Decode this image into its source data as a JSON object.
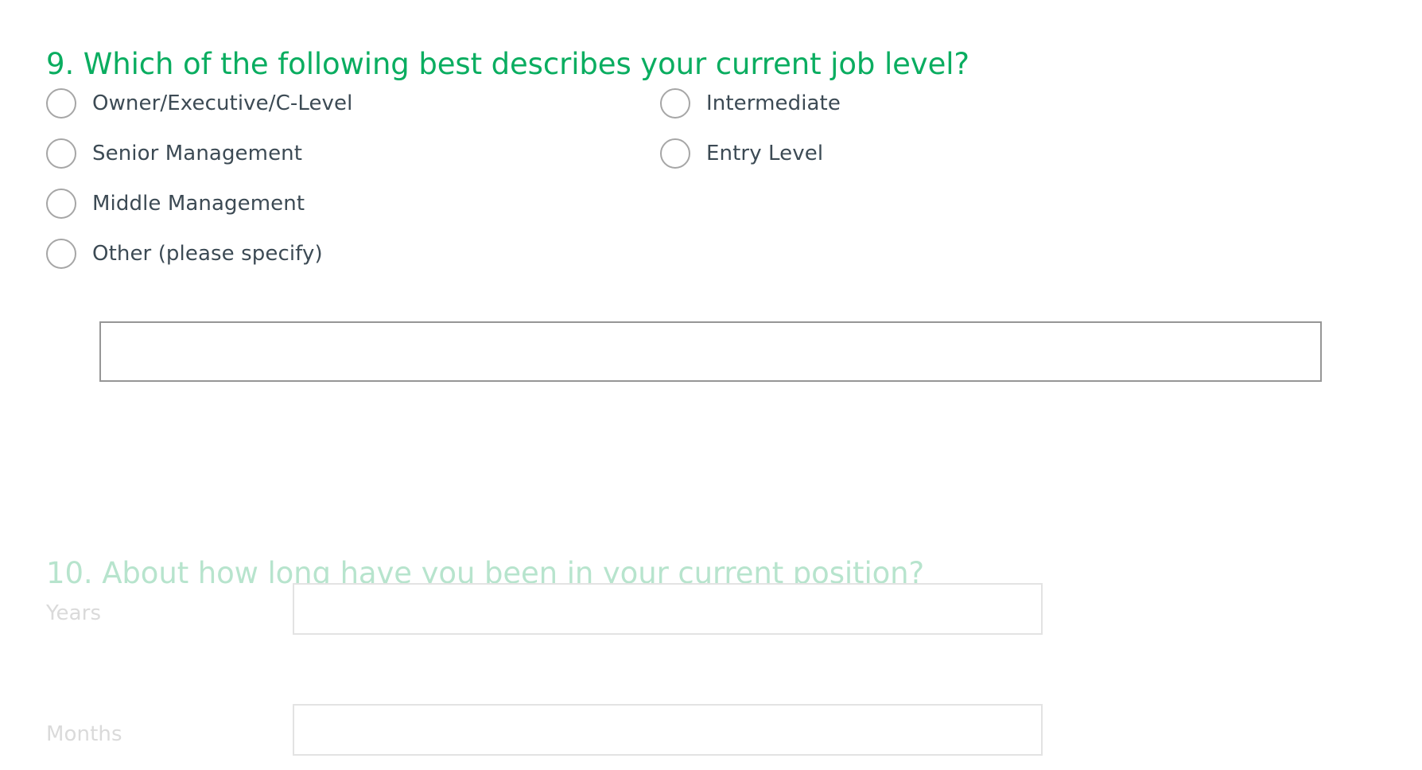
{
  "theme": {
    "accent_green": "#0aad60",
    "accent_green_faded": "#b7e4cd",
    "label_text": "#3c4a54",
    "label_text_faded": "#dadada",
    "input_border": "#969696",
    "input_border_faded": "#e3e3e3",
    "radio_border": "#a6a6a6",
    "background": "#ffffff"
  },
  "questions": [
    {
      "number": "9.",
      "title": "9. Which of the following best describes your current job level?",
      "state": "active",
      "options_left": [
        {
          "label": "Owner/Executive/C-Level",
          "selected": false
        },
        {
          "label": "Senior Management",
          "selected": false
        },
        {
          "label": "Middle Management",
          "selected": false
        },
        {
          "label": "Other (please specify)",
          "selected": false
        }
      ],
      "options_right": [
        {
          "label": "Intermediate",
          "selected": false
        },
        {
          "label": "Entry Level",
          "selected": false
        }
      ],
      "other_input": {
        "value": "",
        "placeholder": ""
      }
    },
    {
      "number": "10.",
      "title": "10. About how long have you been in your current position?",
      "state": "faded",
      "rows": [
        {
          "label": "Years",
          "value": "",
          "placeholder": ""
        },
        {
          "label": "Months",
          "value": "",
          "placeholder": ""
        }
      ]
    }
  ]
}
